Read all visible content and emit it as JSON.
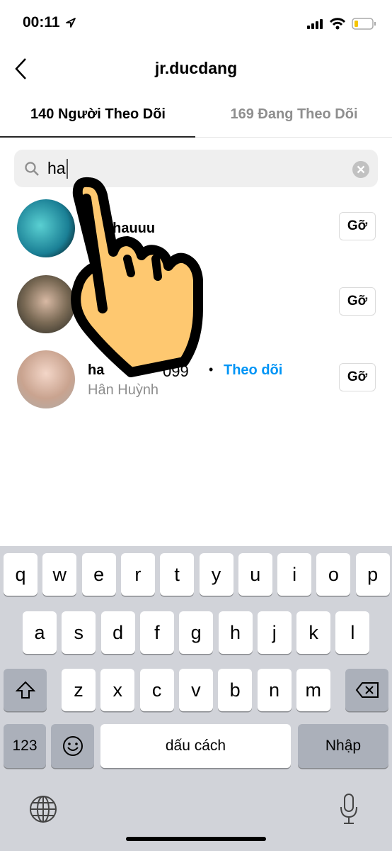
{
  "status_bar": {
    "time": "00:11"
  },
  "header": {
    "title": "jr.ducdang"
  },
  "tabs": [
    {
      "label": "140 Người Theo Dõi",
      "active": true
    },
    {
      "label": "169 Đang Theo Dõi",
      "active": false
    }
  ],
  "search": {
    "value": "ha"
  },
  "list": [
    {
      "username_visible": "chauuu",
      "remove_label": "Gỡ"
    },
    {
      "username_visible": "",
      "remove_label": "Gỡ"
    },
    {
      "username_visible_start": "ha",
      "username_visible_end": "099",
      "separator": "•",
      "follow_label": "Theo dõi",
      "full_name": "Hân Huỳnh",
      "remove_label": "Gỡ"
    }
  ],
  "keyboard": {
    "row1": [
      "q",
      "w",
      "e",
      "r",
      "t",
      "y",
      "u",
      "i",
      "o",
      "p"
    ],
    "row2": [
      "a",
      "s",
      "d",
      "f",
      "g",
      "h",
      "j",
      "k",
      "l"
    ],
    "row3": [
      "z",
      "x",
      "c",
      "v",
      "b",
      "n",
      "m"
    ],
    "numbers_label": "123",
    "space_label": "dấu cách",
    "return_label": "Nhập"
  },
  "colors": {
    "accent": "#0095f6",
    "hand_fill": "#fec870"
  }
}
